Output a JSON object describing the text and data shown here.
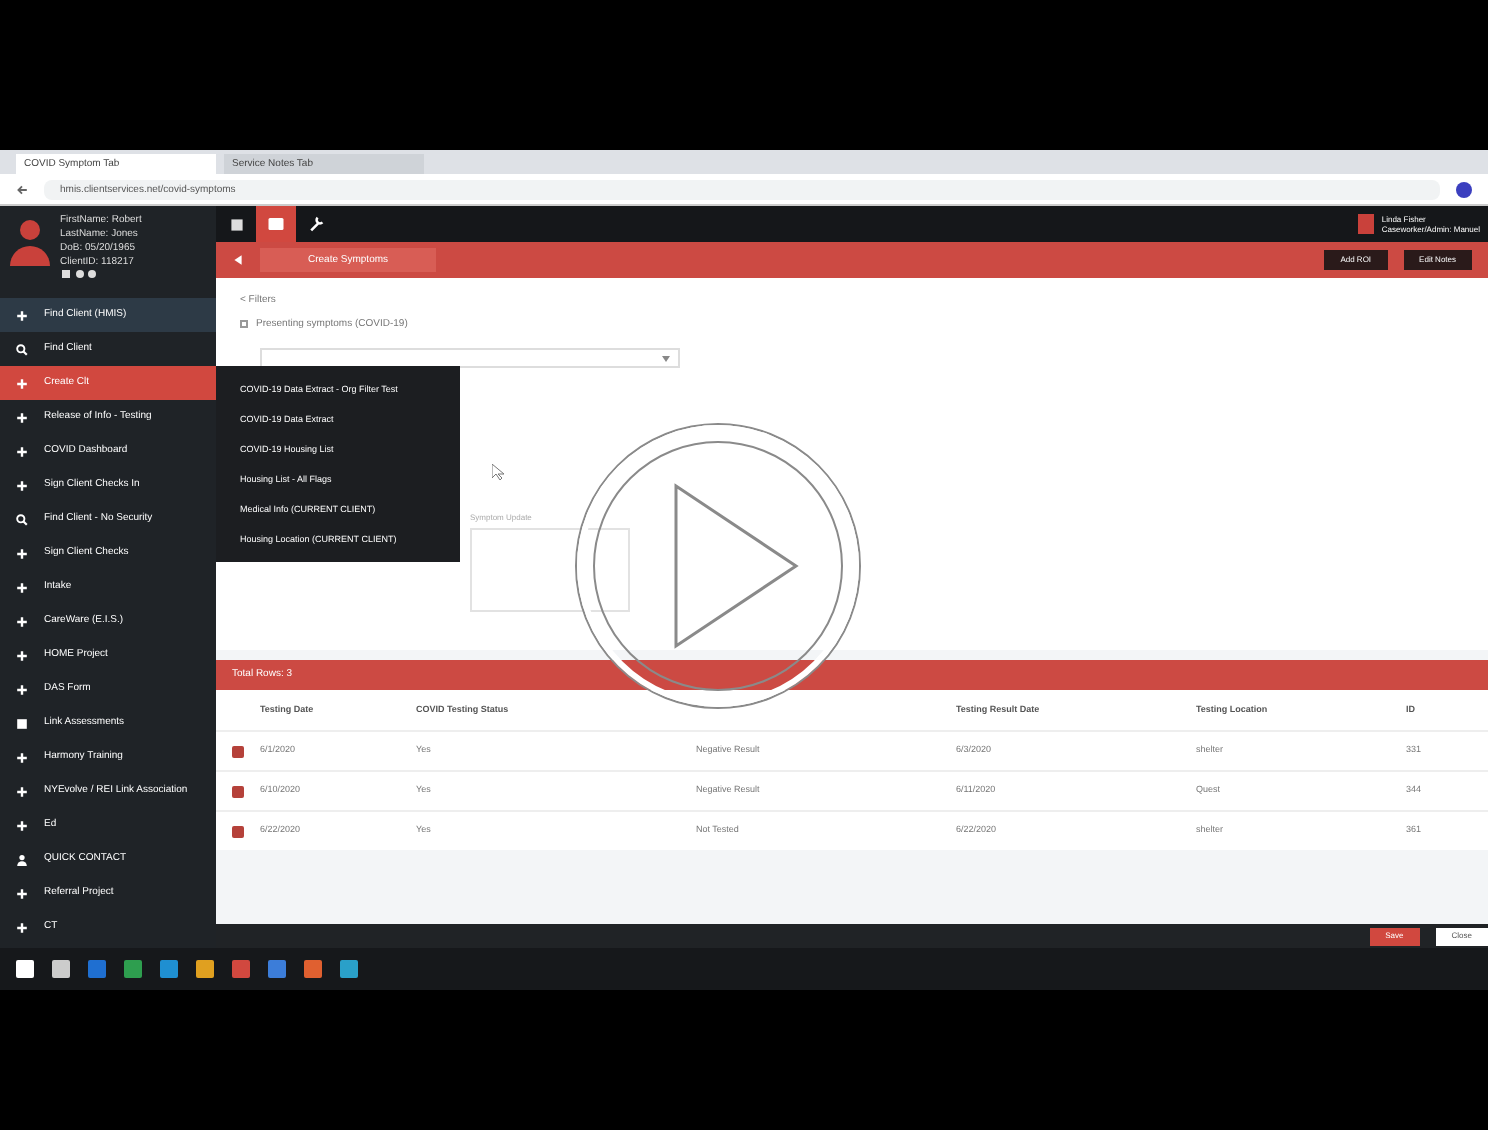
{
  "browser": {
    "tabs": [
      {
        "title": "COVID Symptom Tab",
        "selected": true
      },
      {
        "title": "Service Notes Tab",
        "selected": false
      }
    ],
    "url": "hmis.clientservices.net/covid-symptoms"
  },
  "profile": {
    "lines": [
      "FirstName: Robert",
      "LastName: Jones",
      "DoB: 05/20/1965",
      "ClientID: 118217"
    ]
  },
  "sidebar": {
    "items": [
      {
        "label": "Find Client (HMIS)",
        "kind": "plus",
        "selected": false,
        "hover": true
      },
      {
        "label": "Find Client",
        "kind": "search",
        "selected": false,
        "hover": false
      },
      {
        "label": "Create Clt",
        "kind": "plus",
        "selected": true,
        "hover": false
      },
      {
        "label": "Release of Info - Testing",
        "kind": "plus",
        "selected": false,
        "hover": false
      },
      {
        "label": "COVID Dashboard",
        "kind": "plus",
        "selected": false,
        "hover": false
      },
      {
        "label": "Sign Client Checks In",
        "kind": "plus",
        "selected": false,
        "hover": false
      },
      {
        "label": "Find Client - No Security",
        "kind": "search",
        "selected": false,
        "hover": false
      },
      {
        "label": "Sign Client Checks",
        "kind": "plus",
        "selected": false,
        "hover": false
      },
      {
        "label": "Intake",
        "kind": "plus",
        "selected": false,
        "hover": false
      },
      {
        "label": "CareWare (E.I.S.)",
        "kind": "plus",
        "selected": false,
        "hover": false
      },
      {
        "label": "HOME Project",
        "kind": "plus",
        "selected": false,
        "hover": false
      },
      {
        "label": "DAS Form",
        "kind": "plus",
        "selected": false,
        "hover": false
      },
      {
        "label": "Link Assessments",
        "kind": "doc",
        "selected": false,
        "hover": false
      },
      {
        "label": "Harmony Training",
        "kind": "plus",
        "selected": false,
        "hover": false
      },
      {
        "label": "NYEvolve / REI Link Association",
        "kind": "plus",
        "selected": false,
        "hover": false
      },
      {
        "label": "Ed",
        "kind": "plus",
        "selected": false,
        "hover": false
      },
      {
        "label": "QUICK CONTACT",
        "kind": "person",
        "selected": false,
        "hover": false
      },
      {
        "label": "Referral Project",
        "kind": "plus",
        "selected": false,
        "hover": false
      },
      {
        "label": "CT",
        "kind": "plus",
        "selected": false,
        "hover": false
      }
    ]
  },
  "topbar": {
    "tabs": [
      {
        "kind": "grid",
        "selected": false
      },
      {
        "kind": "card",
        "selected": true
      },
      {
        "kind": "wrench",
        "selected": false
      }
    ],
    "user": [
      "Linda Fisher",
      "Caseworker/Admin: Manuel"
    ]
  },
  "subbar": {
    "tab": "Create Symptoms",
    "buttons": [
      "Add ROI",
      "Edit Notes"
    ]
  },
  "form": {
    "breadcrumb": "< Filters",
    "checkbox": {
      "label": "Presenting symptoms (COVID-19)",
      "checked": false
    },
    "note_label": "Symptom Update"
  },
  "menu": {
    "items": [
      "COVID-19 Data Extract - Org Filter Test",
      "COVID-19 Data Extract",
      "COVID-19 Housing List",
      "Housing List - All Flags",
      "Medical Info (CURRENT CLIENT)",
      "Housing Location (CURRENT CLIENT)"
    ]
  },
  "table": {
    "title": "Total Rows: 3",
    "columns": [
      {
        "label": "Testing Date"
      },
      {
        "label": "COVID Testing Status"
      },
      {},
      {
        "label": "Testing Result Date"
      },
      {
        "label": "Testing Location"
      },
      {
        "label": "ID"
      }
    ],
    "rows": [
      [
        "6/1/2020",
        "Yes",
        "Negative Result",
        "6/3/2020",
        "shelter",
        "331"
      ],
      [
        "6/10/2020",
        "Yes",
        "Negative Result",
        "6/11/2020",
        "Quest",
        "344"
      ],
      [
        "6/22/2020",
        "Yes",
        "Not Tested",
        "6/22/2020",
        "shelter",
        "361"
      ]
    ]
  },
  "footer": {
    "buttons": [
      {
        "label": "Save",
        "kind": "primary"
      },
      {
        "label": "Close",
        "kind": "secondary"
      }
    ]
  }
}
